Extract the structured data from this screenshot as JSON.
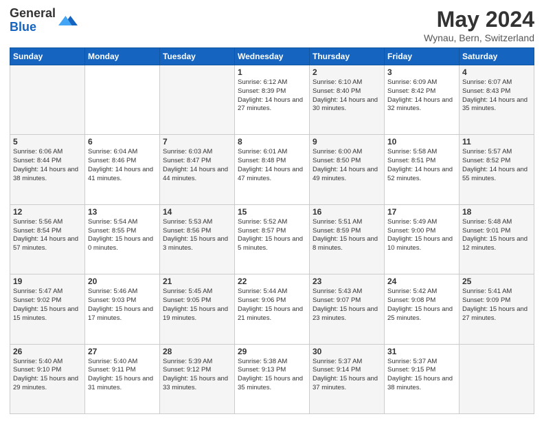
{
  "header": {
    "logo_general": "General",
    "logo_blue": "Blue",
    "title": "May 2024",
    "subtitle": "Wynau, Bern, Switzerland"
  },
  "weekdays": [
    "Sunday",
    "Monday",
    "Tuesday",
    "Wednesday",
    "Thursday",
    "Friday",
    "Saturday"
  ],
  "weeks": [
    [
      {
        "day": "",
        "text": ""
      },
      {
        "day": "",
        "text": ""
      },
      {
        "day": "",
        "text": ""
      },
      {
        "day": "1",
        "text": "Sunrise: 6:12 AM\nSunset: 8:39 PM\nDaylight: 14 hours and 27 minutes."
      },
      {
        "day": "2",
        "text": "Sunrise: 6:10 AM\nSunset: 8:40 PM\nDaylight: 14 hours and 30 minutes."
      },
      {
        "day": "3",
        "text": "Sunrise: 6:09 AM\nSunset: 8:42 PM\nDaylight: 14 hours and 32 minutes."
      },
      {
        "day": "4",
        "text": "Sunrise: 6:07 AM\nSunset: 8:43 PM\nDaylight: 14 hours and 35 minutes."
      }
    ],
    [
      {
        "day": "5",
        "text": "Sunrise: 6:06 AM\nSunset: 8:44 PM\nDaylight: 14 hours and 38 minutes."
      },
      {
        "day": "6",
        "text": "Sunrise: 6:04 AM\nSunset: 8:46 PM\nDaylight: 14 hours and 41 minutes."
      },
      {
        "day": "7",
        "text": "Sunrise: 6:03 AM\nSunset: 8:47 PM\nDaylight: 14 hours and 44 minutes."
      },
      {
        "day": "8",
        "text": "Sunrise: 6:01 AM\nSunset: 8:48 PM\nDaylight: 14 hours and 47 minutes."
      },
      {
        "day": "9",
        "text": "Sunrise: 6:00 AM\nSunset: 8:50 PM\nDaylight: 14 hours and 49 minutes."
      },
      {
        "day": "10",
        "text": "Sunrise: 5:58 AM\nSunset: 8:51 PM\nDaylight: 14 hours and 52 minutes."
      },
      {
        "day": "11",
        "text": "Sunrise: 5:57 AM\nSunset: 8:52 PM\nDaylight: 14 hours and 55 minutes."
      }
    ],
    [
      {
        "day": "12",
        "text": "Sunrise: 5:56 AM\nSunset: 8:54 PM\nDaylight: 14 hours and 57 minutes."
      },
      {
        "day": "13",
        "text": "Sunrise: 5:54 AM\nSunset: 8:55 PM\nDaylight: 15 hours and 0 minutes."
      },
      {
        "day": "14",
        "text": "Sunrise: 5:53 AM\nSunset: 8:56 PM\nDaylight: 15 hours and 3 minutes."
      },
      {
        "day": "15",
        "text": "Sunrise: 5:52 AM\nSunset: 8:57 PM\nDaylight: 15 hours and 5 minutes."
      },
      {
        "day": "16",
        "text": "Sunrise: 5:51 AM\nSunset: 8:59 PM\nDaylight: 15 hours and 8 minutes."
      },
      {
        "day": "17",
        "text": "Sunrise: 5:49 AM\nSunset: 9:00 PM\nDaylight: 15 hours and 10 minutes."
      },
      {
        "day": "18",
        "text": "Sunrise: 5:48 AM\nSunset: 9:01 PM\nDaylight: 15 hours and 12 minutes."
      }
    ],
    [
      {
        "day": "19",
        "text": "Sunrise: 5:47 AM\nSunset: 9:02 PM\nDaylight: 15 hours and 15 minutes."
      },
      {
        "day": "20",
        "text": "Sunrise: 5:46 AM\nSunset: 9:03 PM\nDaylight: 15 hours and 17 minutes."
      },
      {
        "day": "21",
        "text": "Sunrise: 5:45 AM\nSunset: 9:05 PM\nDaylight: 15 hours and 19 minutes."
      },
      {
        "day": "22",
        "text": "Sunrise: 5:44 AM\nSunset: 9:06 PM\nDaylight: 15 hours and 21 minutes."
      },
      {
        "day": "23",
        "text": "Sunrise: 5:43 AM\nSunset: 9:07 PM\nDaylight: 15 hours and 23 minutes."
      },
      {
        "day": "24",
        "text": "Sunrise: 5:42 AM\nSunset: 9:08 PM\nDaylight: 15 hours and 25 minutes."
      },
      {
        "day": "25",
        "text": "Sunrise: 5:41 AM\nSunset: 9:09 PM\nDaylight: 15 hours and 27 minutes."
      }
    ],
    [
      {
        "day": "26",
        "text": "Sunrise: 5:40 AM\nSunset: 9:10 PM\nDaylight: 15 hours and 29 minutes."
      },
      {
        "day": "27",
        "text": "Sunrise: 5:40 AM\nSunset: 9:11 PM\nDaylight: 15 hours and 31 minutes."
      },
      {
        "day": "28",
        "text": "Sunrise: 5:39 AM\nSunset: 9:12 PM\nDaylight: 15 hours and 33 minutes."
      },
      {
        "day": "29",
        "text": "Sunrise: 5:38 AM\nSunset: 9:13 PM\nDaylight: 15 hours and 35 minutes."
      },
      {
        "day": "30",
        "text": "Sunrise: 5:37 AM\nSunset: 9:14 PM\nDaylight: 15 hours and 37 minutes."
      },
      {
        "day": "31",
        "text": "Sunrise: 5:37 AM\nSunset: 9:15 PM\nDaylight: 15 hours and 38 minutes."
      },
      {
        "day": "",
        "text": ""
      }
    ]
  ]
}
